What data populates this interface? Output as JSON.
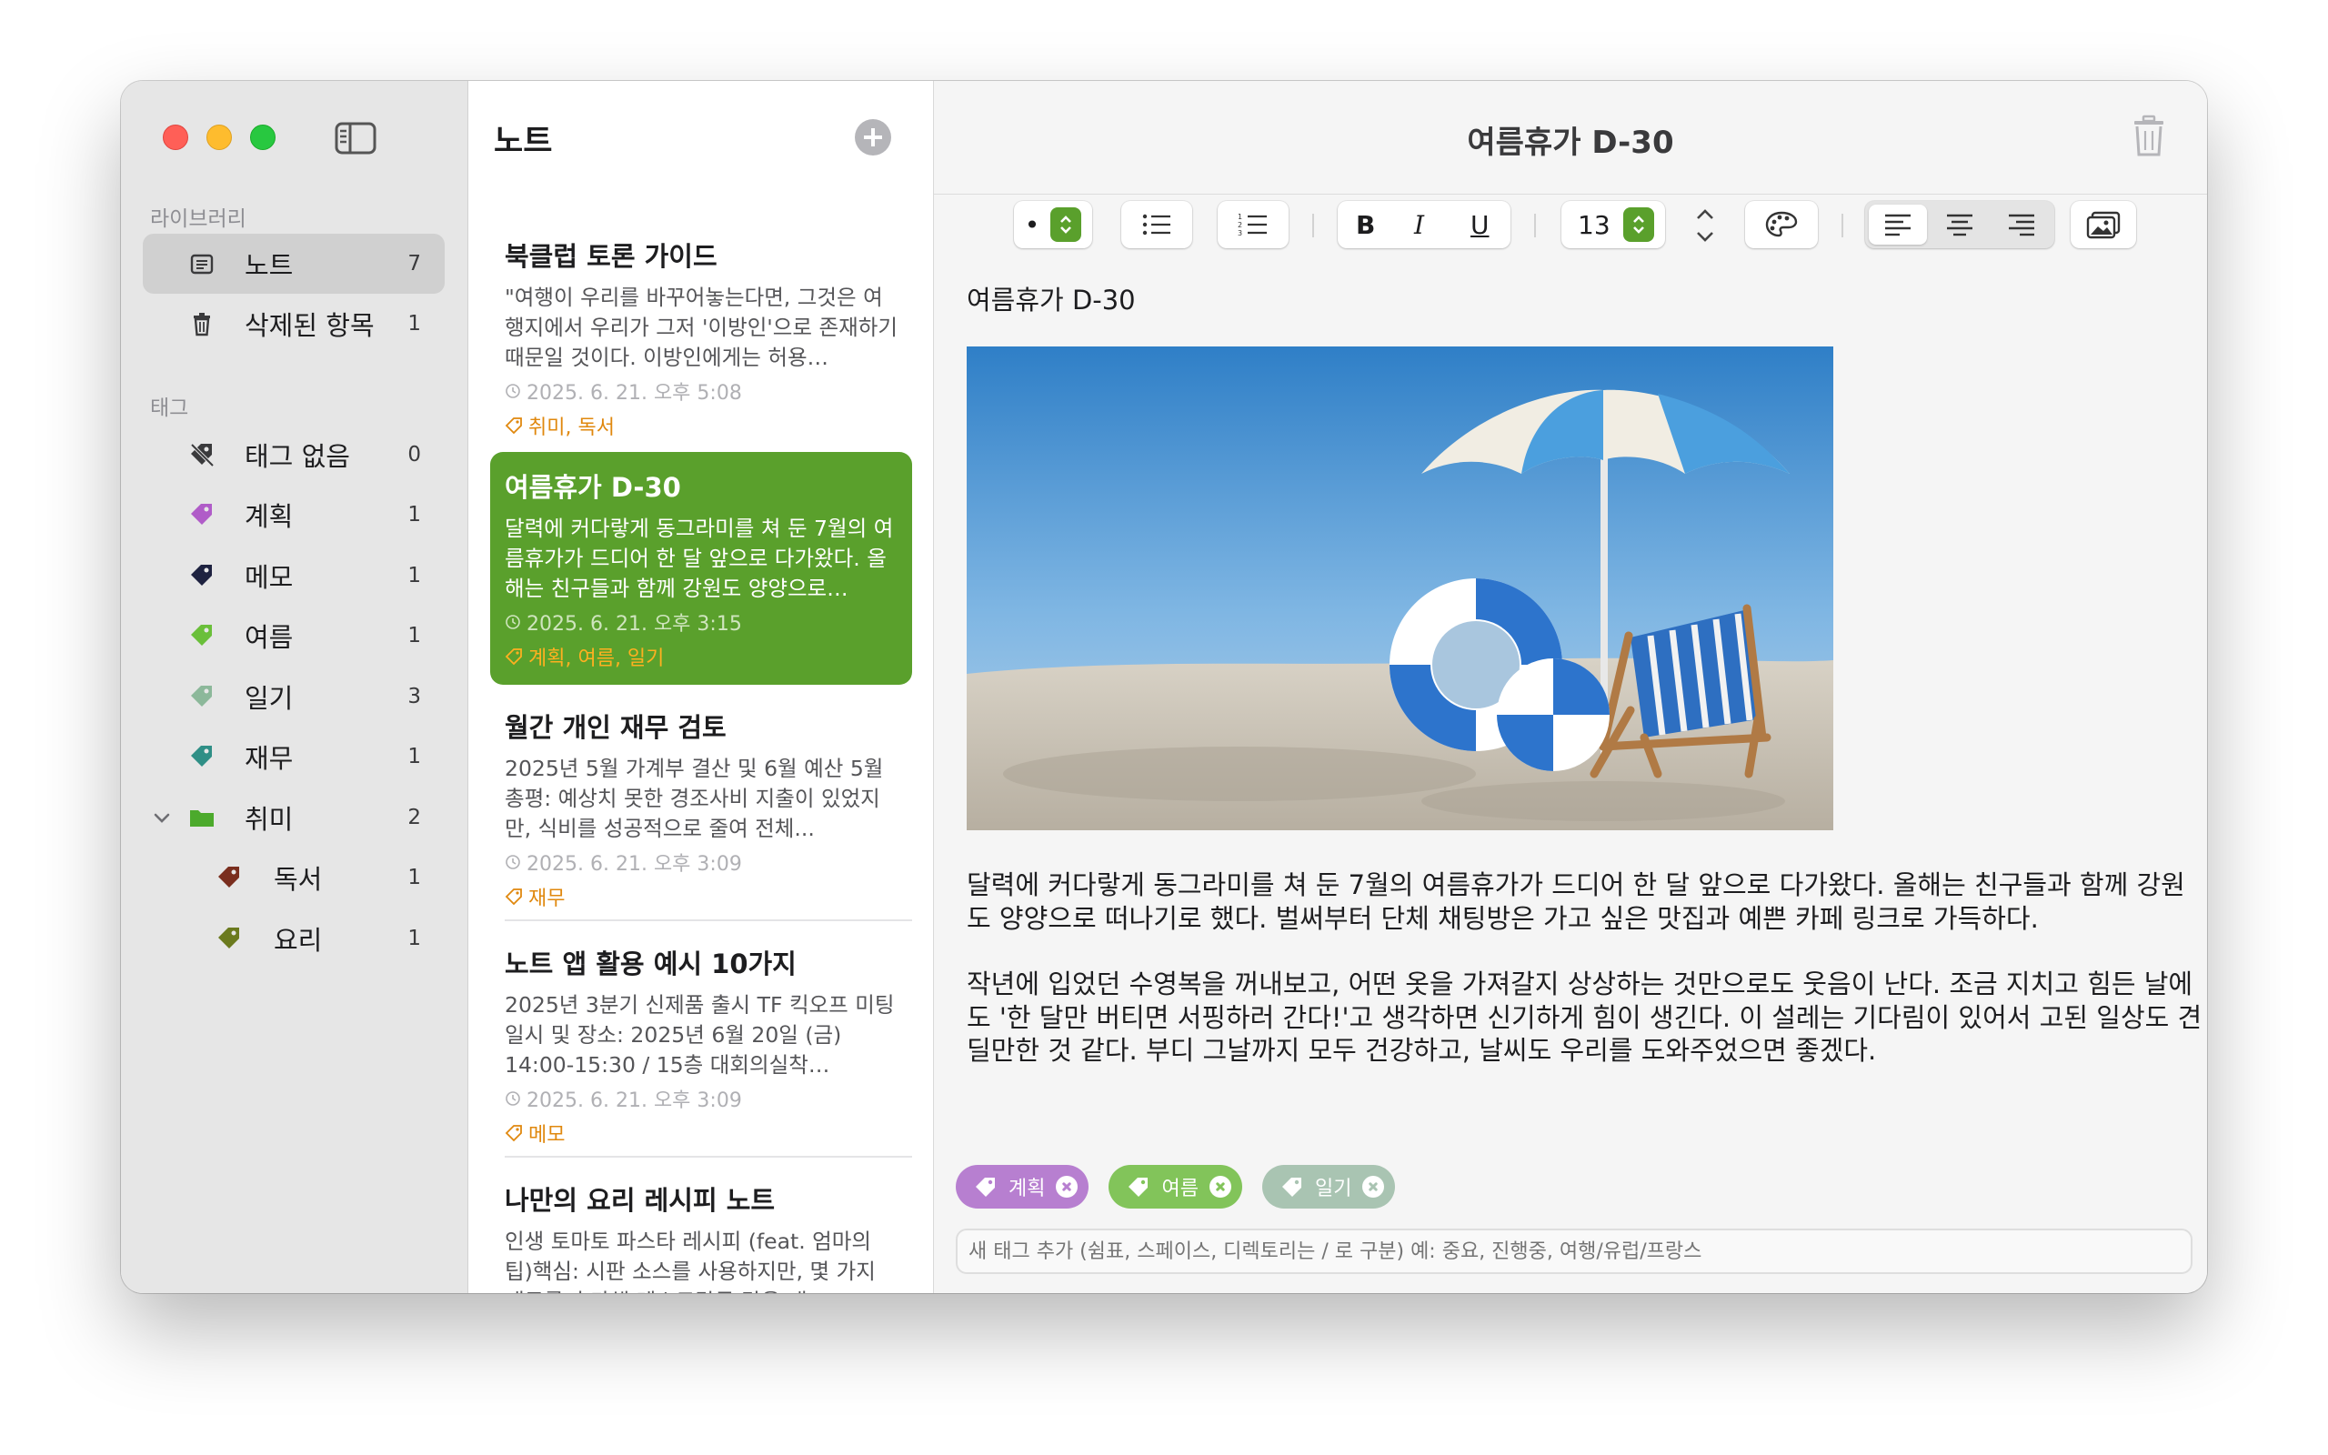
{
  "sidebar": {
    "library_label": "라이브러리",
    "library_items": [
      {
        "label": "노트",
        "count": "7",
        "icon": "note-list-icon"
      },
      {
        "label": "삭제된 항목",
        "count": "1",
        "icon": "trash-icon"
      }
    ],
    "tags_label": "태그",
    "tag_items": [
      {
        "label": "태그 없음",
        "count": "0",
        "color": "#3a3a3c",
        "icon": "no-tag-icon"
      },
      {
        "label": "계획",
        "count": "1",
        "color": "#b05cc8",
        "icon": "tag-icon"
      },
      {
        "label": "메모",
        "count": "1",
        "color": "#1e2240",
        "icon": "tag-icon"
      },
      {
        "label": "여름",
        "count": "1",
        "color": "#6abf3a",
        "icon": "tag-icon"
      },
      {
        "label": "일기",
        "count": "3",
        "color": "#8cb89a",
        "icon": "tag-icon"
      },
      {
        "label": "재무",
        "count": "1",
        "color": "#2f8f86",
        "icon": "tag-icon"
      },
      {
        "label": "취미",
        "count": "2",
        "color": "#4caa2c",
        "icon": "folder-icon"
      },
      {
        "label": "독서",
        "count": "1",
        "color": "#7a2e1e",
        "icon": "tag-icon"
      },
      {
        "label": "요리",
        "count": "1",
        "color": "#6b7a1e",
        "icon": "tag-icon"
      }
    ]
  },
  "notelist": {
    "title": "노트",
    "notes": [
      {
        "title": "북클럽 토론 가이드",
        "preview": "\"여행이 우리를 바꾸어놓는다면, 그것은 여행지에서 우리가 그저 '이방인'으로 존재하기 때문일 것이다. 이방인에게는 허용…",
        "date": "2025. 6. 21. 오후 5:08",
        "tags": "취미, 독서"
      },
      {
        "title": "여름휴가 D-30",
        "preview": "달력에 커다랗게 동그라미를 쳐 둔 7월의 여름휴가가 드디어 한 달 앞으로 다가왔다. 올해는 친구들과 함께 강원도 양양으로…",
        "date": "2025. 6. 21. 오후 3:15",
        "tags": "계획, 여름, 일기"
      },
      {
        "title": "월간 개인 재무 검토",
        "preview": "2025년 5월 가계부 결산 및 6월 예산 5월 총평: 예상치 못한 경조사비 지출이 있었지만, 식비를 성공적으로 줄여 전체...",
        "date": "2025. 6. 21. 오후 3:09",
        "tags": "재무"
      },
      {
        "title": "노트 앱 활용 예시 10가지",
        "preview": "2025년 3분기 신제품 출시 TF 킥오프 미팅일시 및 장소: 2025년 6월 20일 (금) 14:00-15:30 / 15층 대회의실착…",
        "date": "2025. 6. 21. 오후 3:09",
        "tags": "메모"
      },
      {
        "title": "나만의 요리 레시피 노트",
        "preview": "인생 토마토 파스타 레시피 (feat. 엄마의 팁)핵심: 시판 소스를 사용하지만, 몇 가지 재료를 추가해 레스토랑급 맛을 내…",
        "date": "",
        "tags": ""
      }
    ]
  },
  "editor": {
    "title": "여름휴가 D-30",
    "toolbar": {
      "bullet_style": "•",
      "bold": "B",
      "italic": "I",
      "underline": "U",
      "font_size": "13",
      "alignment": "left"
    },
    "heading": "여름휴가 D-30",
    "paragraphs": [
      "달력에 커다랗게 동그라미를 쳐 둔 7월의 여름휴가가 드디어 한 달 앞으로 다가왔다. 올해는 친구들과 함께 강원도 양양으로 떠나기로 했다. 벌써부터 단체 채팅방은 가고 싶은 맛집과 예쁜 카페 링크로 가득하다.",
      "작년에 입었던 수영복을 꺼내보고, 어떤 옷을 가져갈지 상상하는 것만으로도 웃음이 난다. 조금 지치고 힘든 날에도 '한 달만 버티면 서핑하러 간다!'고 생각하면 신기하게 힘이 생긴다. 이 설레는 기다림이 있어서 고된 일상도 견딜만한 것 같다. 부디 그날까지 모두 건강하고, 날씨도 우리를 도와주었으면 좋겠다."
    ],
    "tags": [
      {
        "label": "계획",
        "color": "#b77fd0"
      },
      {
        "label": "여름",
        "color": "#82c45a"
      },
      {
        "label": "일기",
        "color": "#a9c4b2"
      }
    ],
    "tag_input_placeholder": "새 태그 추가 (쉼표, 스페이스, 디렉토리는 / 로 구분) 예: 중요, 진행중, 여행/유럽/프랑스"
  }
}
